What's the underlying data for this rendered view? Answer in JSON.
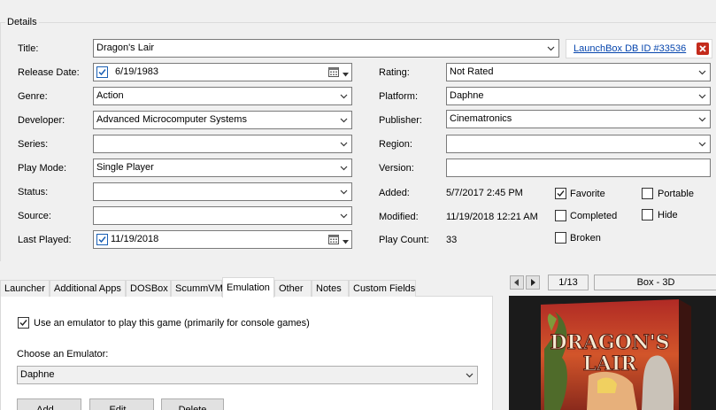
{
  "details": {
    "group_title": "Details",
    "title_label": "Title:",
    "title_value": "Dragon's Lair",
    "db_link": "LaunchBox DB ID #33536",
    "release_date_label": "Release Date:",
    "release_date_value": "6/19/1983",
    "genre_label": "Genre:",
    "genre_value": "Action",
    "developer_label": "Developer:",
    "developer_value": "Advanced Microcomputer Systems",
    "series_label": "Series:",
    "series_value": "",
    "play_mode_label": "Play Mode:",
    "play_mode_value": "Single Player",
    "status_label": "Status:",
    "status_value": "",
    "source_label": "Source:",
    "source_value": "",
    "last_played_label": "Last Played:",
    "last_played_value": "11/19/2018",
    "rating_label": "Rating:",
    "rating_value": "Not Rated",
    "platform_label": "Platform:",
    "platform_value": "Daphne",
    "publisher_label": "Publisher:",
    "publisher_value": "Cinematronics",
    "region_label": "Region:",
    "region_value": "",
    "version_label": "Version:",
    "version_value": "",
    "added_label": "Added:",
    "added_value": "5/7/2017 2:45 PM",
    "modified_label": "Modified:",
    "modified_value": "11/19/2018 12:21 AM",
    "play_count_label": "Play Count:",
    "play_count_value": "33",
    "flags": {
      "favorite": {
        "label": "Favorite",
        "checked": true
      },
      "portable": {
        "label": "Portable",
        "checked": false
      },
      "completed": {
        "label": "Completed",
        "checked": false
      },
      "hide": {
        "label": "Hide",
        "checked": false
      },
      "broken": {
        "label": "Broken",
        "checked": false
      }
    }
  },
  "tabs": [
    {
      "label": "Launcher",
      "active": false
    },
    {
      "label": "Additional Apps",
      "active": false
    },
    {
      "label": "DOSBox",
      "active": false
    },
    {
      "label": "ScummVM",
      "active": false
    },
    {
      "label": "Emulation",
      "active": true
    },
    {
      "label": "Other",
      "active": false
    },
    {
      "label": "Notes",
      "active": false
    },
    {
      "label": "Custom Fields",
      "active": false
    }
  ],
  "emulation": {
    "use_emulator_label": "Use an emulator to play this game (primarily for console games)",
    "use_emulator_checked": true,
    "choose_label": "Choose an Emulator:",
    "emulator_value": "Daphne",
    "add_button": "Add...",
    "edit_button": "Edit...",
    "delete_button": "Delete"
  },
  "image_panel": {
    "counter": "1/13",
    "image_type": "Box - 3D",
    "cover_title_line1": "DRAGON'S",
    "cover_title_line2": "LAIR"
  },
  "colors": {
    "link": "#0645ad",
    "close_red": "#c42b1c",
    "check_blue": "#1a5fb4"
  }
}
